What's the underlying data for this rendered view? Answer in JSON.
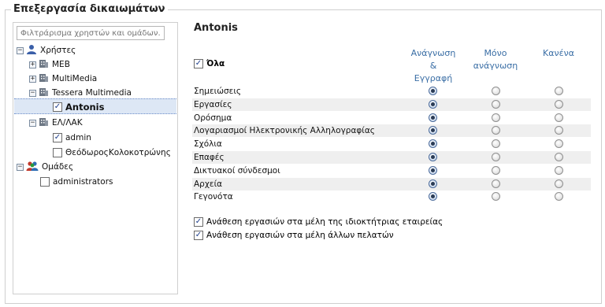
{
  "legend": "Επεξεργασία δικαιωμάτων",
  "tree": {
    "filter_placeholder": "Φιλτράρισμα χρηστών και ομάδων...",
    "users_label": "Χρήστες",
    "groups_label": "Ομάδες",
    "orgs": [
      {
        "label": "MEB"
      },
      {
        "label": "MultiMedia"
      },
      {
        "label": "Tessera Multimedia"
      },
      {
        "label": "Antonis"
      },
      {
        "label": "ΕΛ/ΛΑΚ"
      },
      {
        "label": "admin"
      },
      {
        "label": "ΘεόδωροςΚολοκοτρώνης"
      }
    ],
    "group_items": [
      {
        "label": "administrators"
      }
    ]
  },
  "panel": {
    "user_name": "Antonis",
    "all_label": "Όλα",
    "col_readwrite": [
      "Ανάγνωση",
      "&",
      "Εγγραφή"
    ],
    "col_readonly": [
      "Μόνο",
      "ανάγνωση"
    ],
    "col_none": "Κανένα",
    "permissions": [
      {
        "label": "Σημειώσεις",
        "value": "readwrite"
      },
      {
        "label": "Εργασίες",
        "value": "readwrite"
      },
      {
        "label": "Ορόσημα",
        "value": "readwrite"
      },
      {
        "label": "Λογαριασμοί Ηλεκτρονικής Αλληλογραφίας",
        "value": "readwrite"
      },
      {
        "label": "Σχόλια",
        "value": "readwrite"
      },
      {
        "label": "Επαφές",
        "value": "readwrite"
      },
      {
        "label": "Δικτυακοί σύνδεσμοι",
        "value": "readwrite"
      },
      {
        "label": "Αρχεία",
        "value": "readwrite"
      },
      {
        "label": "Γεγονότα",
        "value": "readwrite"
      }
    ],
    "assign_own": "Ανάθεση εργασιών στα μέλη της ιδιοκτήτριας εταιρείας",
    "assign_clients": "Ανάθεση εργασιών στα μέλη άλλων πελατών"
  },
  "colors": {
    "accent": "#3a6ea5",
    "selected": "#dde7f5"
  }
}
